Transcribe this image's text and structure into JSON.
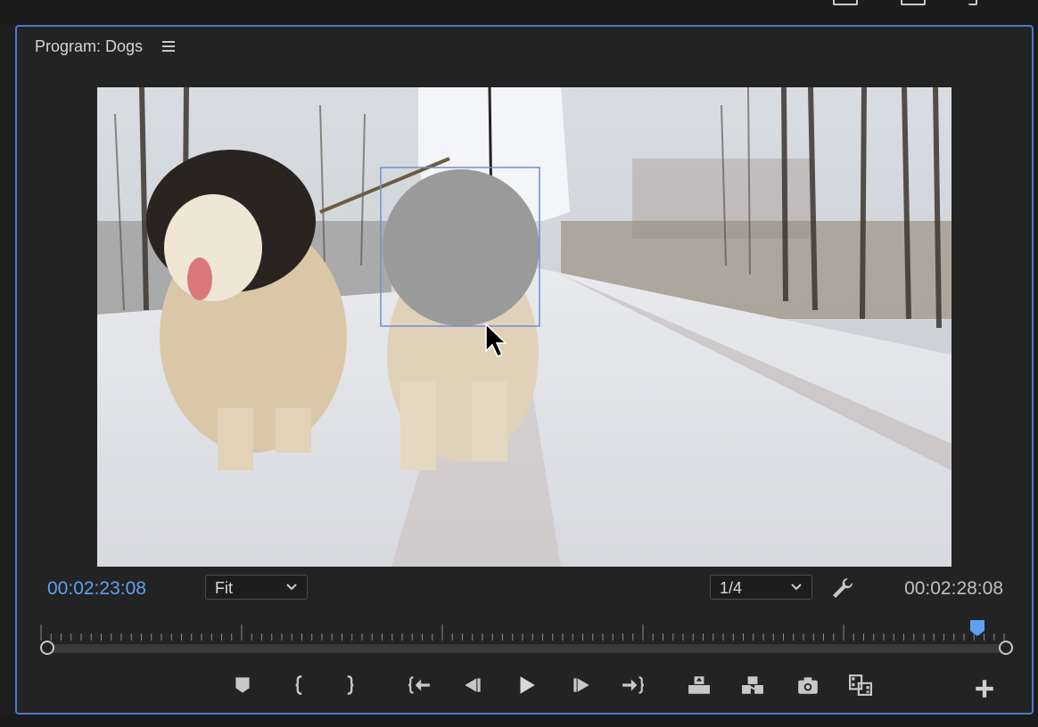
{
  "panel": {
    "title": "Program: Dogs",
    "menu_icon": "hamburger-menu-icon",
    "accent_color": "#4a79c9"
  },
  "monitor": {
    "current_timecode": "00:02:23:08",
    "duration_timecode": "00:02:28:08",
    "timecode_color": "#5fa0f0",
    "zoom": {
      "selected": "Fit"
    },
    "resolution": {
      "selected": "1/4"
    },
    "settings_icon": "wrench-icon",
    "playhead_progress": 0.972
  },
  "controls": [
    {
      "name": "add-marker-button",
      "icon": "marker-icon"
    },
    {
      "name": "mark-in-button",
      "icon": "mark-in-icon"
    },
    {
      "name": "mark-out-button",
      "icon": "mark-out-icon"
    },
    {
      "name": "go-to-in-button",
      "icon": "go-to-in-icon"
    },
    {
      "name": "step-back-button",
      "icon": "step-back-icon"
    },
    {
      "name": "play-button",
      "icon": "play-icon"
    },
    {
      "name": "step-forward-button",
      "icon": "step-forward-icon"
    },
    {
      "name": "go-to-out-button",
      "icon": "go-to-out-icon"
    },
    {
      "name": "lift-button",
      "icon": "lift-icon"
    },
    {
      "name": "extract-button",
      "icon": "extract-icon"
    },
    {
      "name": "export-frame-button",
      "icon": "camera-icon"
    },
    {
      "name": "comparison-view-button",
      "icon": "comparison-view-icon"
    },
    {
      "name": "button-editor-button",
      "icon": "plus-icon"
    }
  ]
}
